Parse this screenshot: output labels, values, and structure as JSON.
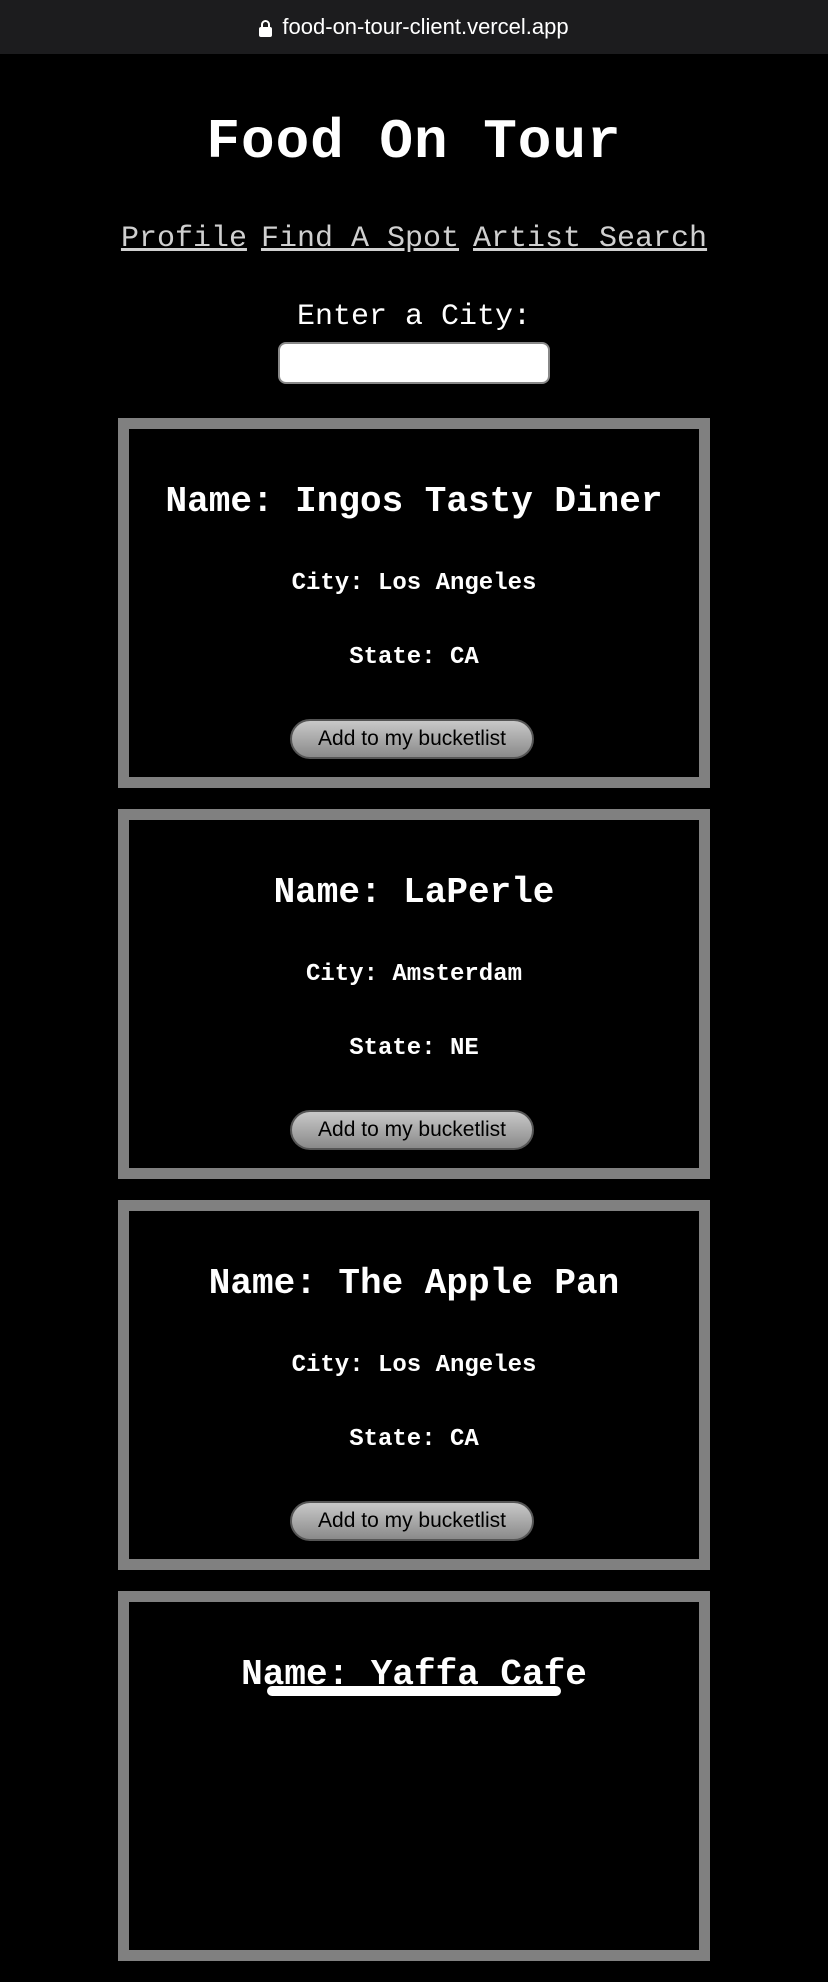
{
  "browser": {
    "url": "food-on-tour-client.vercel.app"
  },
  "header": {
    "title": "Food On Tour"
  },
  "nav": {
    "items": [
      "Profile",
      "Find A Spot",
      "Artist Search"
    ]
  },
  "search": {
    "label": "Enter a City:",
    "value": "",
    "placeholder": ""
  },
  "restaurants": [
    {
      "name": "Name: Ingos Tasty Diner",
      "city": "City: Los Angeles",
      "state": "State: CA",
      "button": "Add to my bucketlist"
    },
    {
      "name": "Name: LaPerle",
      "city": "City: Amsterdam",
      "state": "State: NE",
      "button": "Add to my bucketlist"
    },
    {
      "name": "Name: The Apple Pan",
      "city": "City: Los Angeles",
      "state": "State: CA",
      "button": "Add to my bucketlist"
    },
    {
      "name": "Name: Yaffa Cafe"
    }
  ]
}
